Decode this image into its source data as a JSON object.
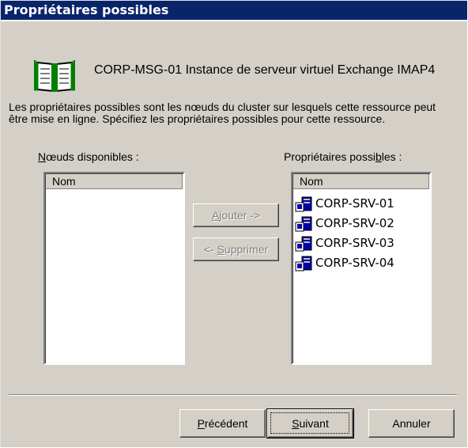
{
  "window": {
    "title": "Propriétaires possibles"
  },
  "resource": {
    "icon": "book-icon",
    "name": "CORP-MSG-01 Instance de serveur virtuel Exchange IMAP4"
  },
  "description": "Les propriétaires possibles sont les nœuds du cluster sur lesquels cette ressource peut être mise en ligne. Spécifiez les propriétaires possibles pour cette ressource.",
  "available": {
    "label_pre": "",
    "label_accel": "N",
    "label_post": "œuds disponibles :",
    "column": "Nom",
    "items": []
  },
  "owners": {
    "label_pre": "Propriétaires possi",
    "label_accel": "b",
    "label_post": "les :",
    "column": "Nom",
    "items": [
      {
        "name": "CORP-SRV-01",
        "icon": "server-node-icon"
      },
      {
        "name": "CORP-SRV-02",
        "icon": "server-node-icon"
      },
      {
        "name": "CORP-SRV-03",
        "icon": "server-node-icon"
      },
      {
        "name": "CORP-SRV-04",
        "icon": "server-node-icon"
      }
    ]
  },
  "actions": {
    "add": {
      "pre": "",
      "accel": "A",
      "post": "jouter ->",
      "enabled": false
    },
    "remove": {
      "pre": "<- ",
      "accel": "S",
      "post": "upprimer",
      "enabled": false
    }
  },
  "wizard": {
    "back": {
      "pre": "",
      "accel": "P",
      "post": "récédent"
    },
    "next": {
      "pre": "",
      "accel": "S",
      "post": "uivant"
    },
    "cancel": {
      "label": "Annuler"
    }
  },
  "colors": {
    "title_bar": "#0a246a",
    "face": "#d4d0c8",
    "icon_blue": "#0000a8"
  }
}
